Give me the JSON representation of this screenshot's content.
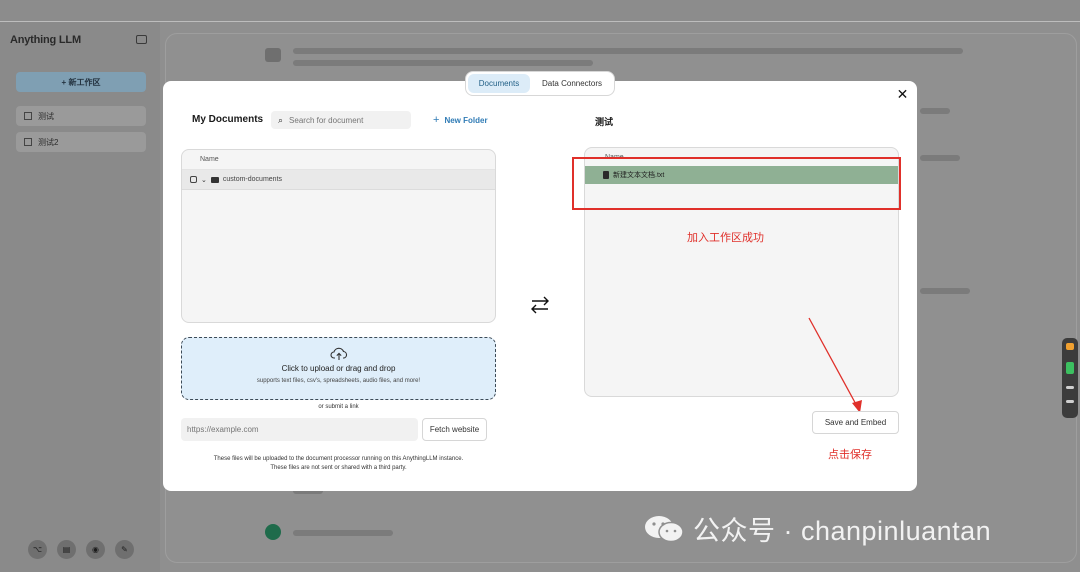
{
  "app": {
    "brand": "Anything LLM",
    "new_workspace_label": "+ 新工作区",
    "workspaces": [
      "测试",
      "测试2"
    ]
  },
  "modal": {
    "tabs": [
      {
        "label": "Documents",
        "active": true
      },
      {
        "label": "Data Connectors",
        "active": false
      }
    ],
    "close_icon": "✕",
    "my_documents": {
      "title": "My Documents",
      "search_placeholder": "Search for document",
      "new_folder_label": "New Folder",
      "column_name": "Name",
      "rows": [
        {
          "name": "custom-documents"
        }
      ]
    },
    "upload": {
      "title": "Click to upload or drag and drop",
      "subtitle": "supports text files, csv's, spreadsheets, audio files, and more!",
      "or_link": "or submit a link",
      "url_placeholder": "https://example.com",
      "fetch_label": "Fetch website",
      "note_line1": "These files will be uploaded to the document processor running on this AnythingLLM instance.",
      "note_line2": "These files are not sent or shared with a third party."
    },
    "workspace": {
      "title": "测试",
      "column_name": "Name",
      "rows": [
        {
          "name": "新建文本文档.txt"
        }
      ],
      "save_label": "Save and Embed"
    }
  },
  "annotations": {
    "added_success": "加入工作区成功",
    "click_save": "点击保存",
    "color": "#e0302a"
  },
  "watermark": {
    "text": "公众号 · chanpinluantan"
  },
  "colors": {
    "accent_tab": "#dcecf8",
    "selected_row": "#8fb094",
    "upload_bg": "#dfeefa"
  }
}
